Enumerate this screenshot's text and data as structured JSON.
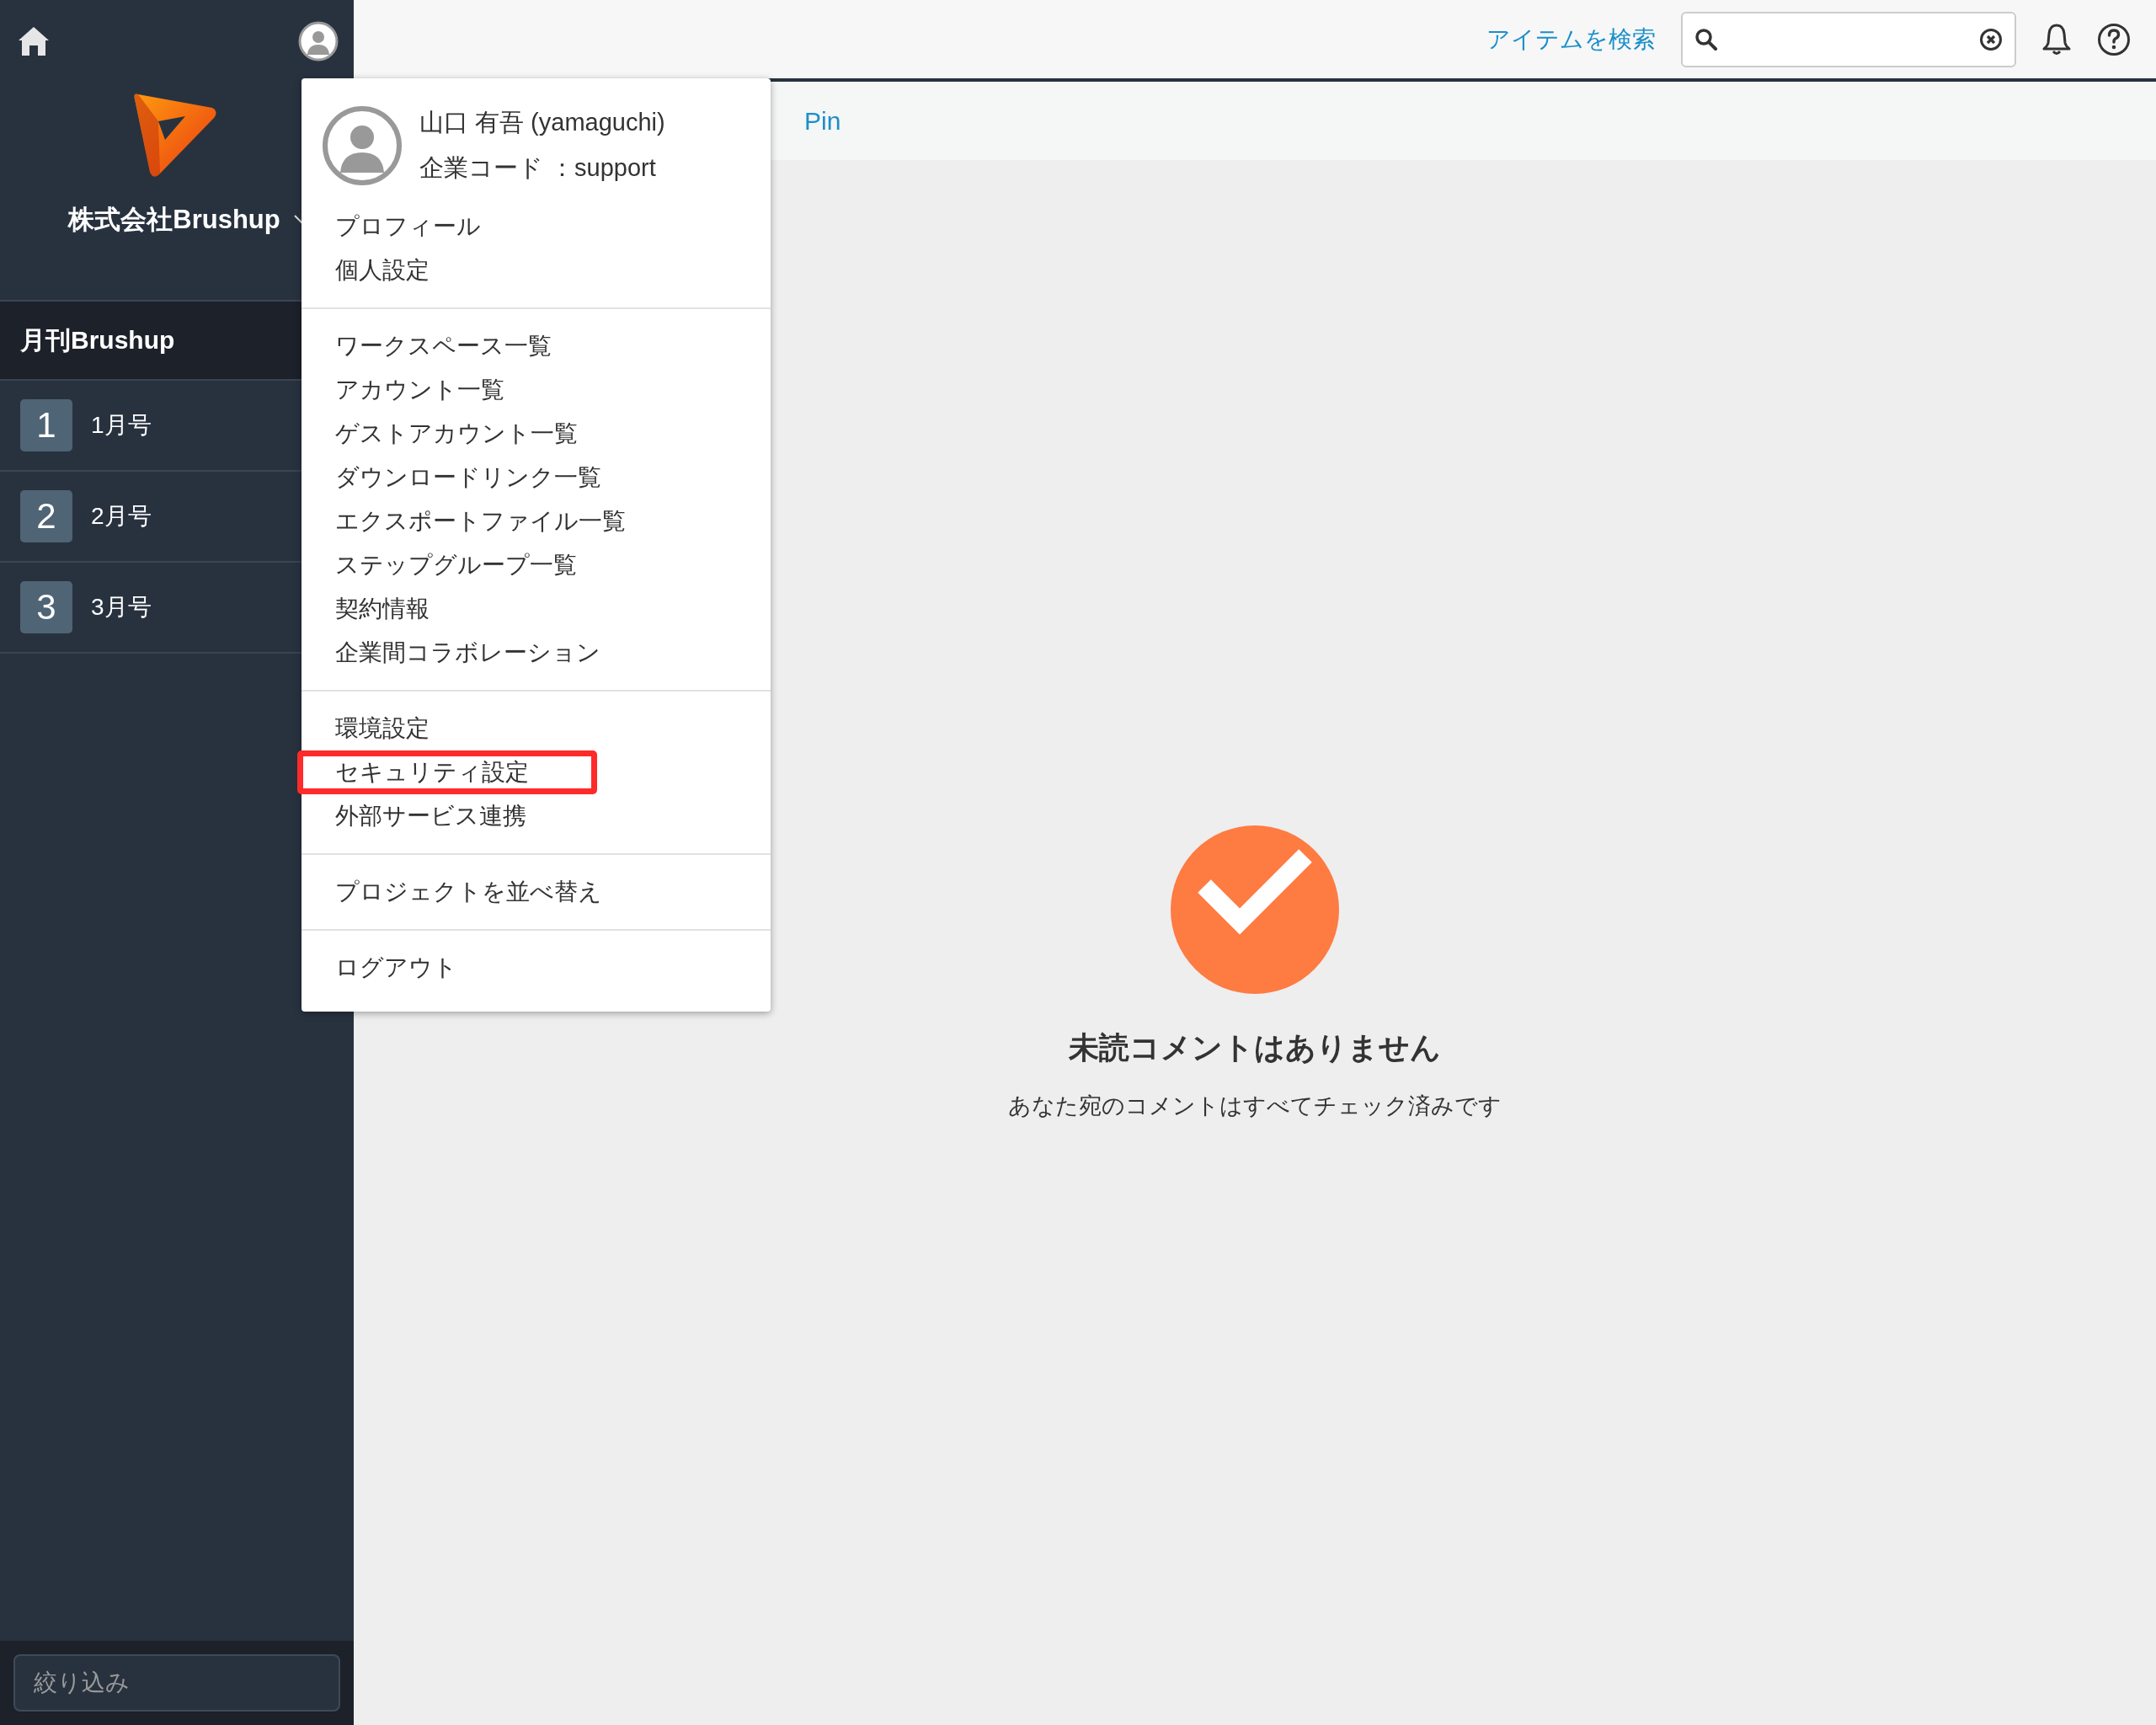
{
  "sidebar": {
    "company": "株式会社Brushup",
    "project": "月刊Brushup",
    "issues": [
      {
        "number": "1",
        "label": "1月号"
      },
      {
        "number": "2",
        "label": "2月号"
      },
      {
        "number": "3",
        "label": "3月号"
      }
    ],
    "filter": {
      "placeholder": "絞り込み"
    }
  },
  "topbar": {
    "search_link": "アイテムを検索"
  },
  "tab_bar": {
    "label": "Pin"
  },
  "user_menu": {
    "name": "山口 有吾 (yamaguchi)",
    "company_code": "企業コード ：support",
    "sections": [
      {
        "items": [
          {
            "label": "プロフィール",
            "highlighted": false
          },
          {
            "label": "個人設定",
            "highlighted": false
          }
        ]
      },
      {
        "items": [
          {
            "label": "ワークスペース一覧",
            "highlighted": false
          },
          {
            "label": "アカウント一覧",
            "highlighted": false
          },
          {
            "label": "ゲストアカウント一覧",
            "highlighted": false
          },
          {
            "label": "ダウンロードリンク一覧",
            "highlighted": false
          },
          {
            "label": "エクスポートファイル一覧",
            "highlighted": false
          },
          {
            "label": "ステップグループ一覧",
            "highlighted": false
          },
          {
            "label": "契約情報",
            "highlighted": false
          },
          {
            "label": "企業間コラボレーション",
            "highlighted": false
          }
        ]
      },
      {
        "items": [
          {
            "label": "環境設定",
            "highlighted": false
          },
          {
            "label": "セキュリティ設定",
            "highlighted": true
          },
          {
            "label": "外部サービス連携",
            "highlighted": false
          }
        ]
      },
      {
        "items": [
          {
            "label": "プロジェクトを並べ替え",
            "highlighted": false
          }
        ]
      },
      {
        "items": [
          {
            "label": "ログアウト",
            "highlighted": false
          }
        ]
      }
    ]
  },
  "empty_state": {
    "title": "未読コメントはありません",
    "message": "あなた宛のコメントはすべてチェック済みです"
  }
}
